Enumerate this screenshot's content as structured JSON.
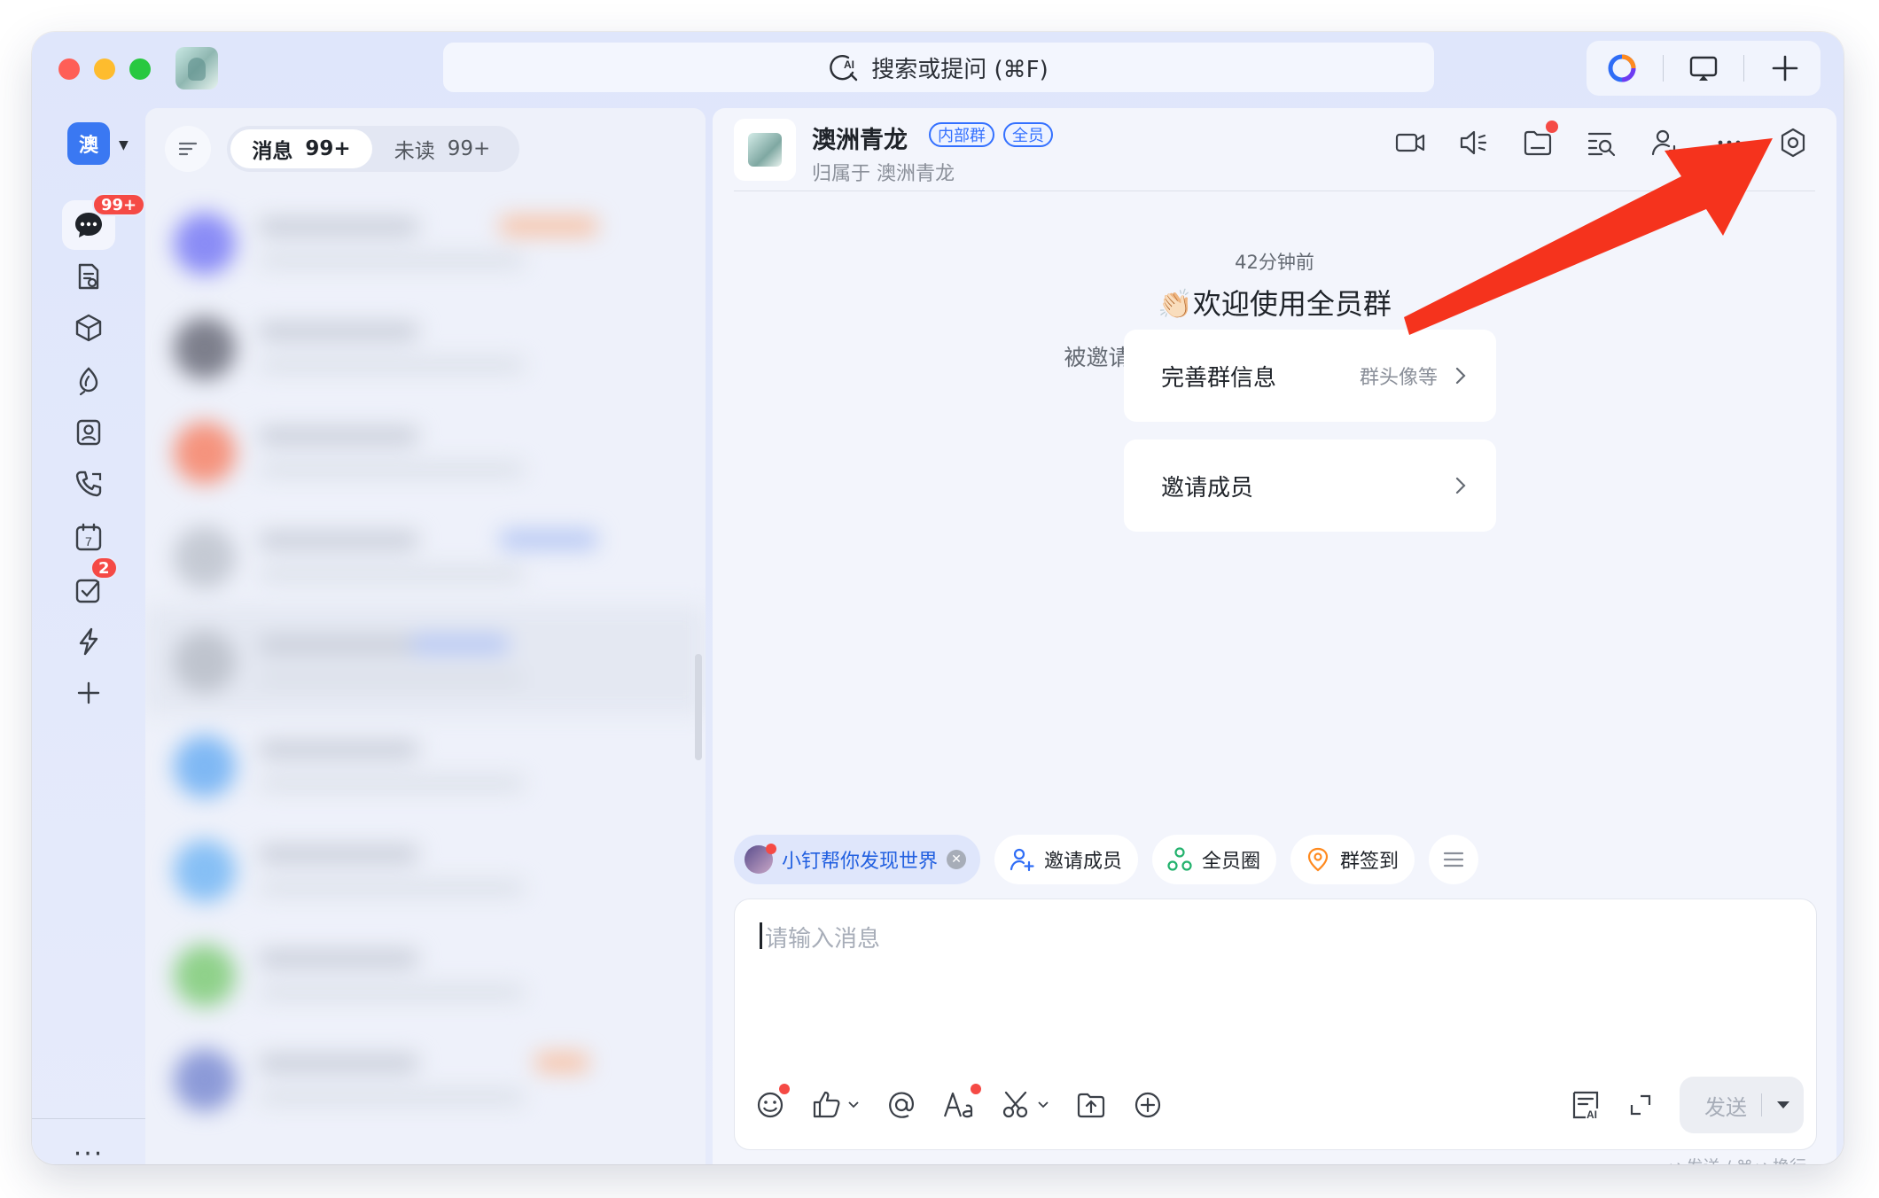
{
  "search": {
    "label": "搜索或提问 (⌘F)"
  },
  "org": {
    "initial": "澳"
  },
  "rail": {
    "messages_badge": "99+",
    "todo_badge": "2",
    "items": [
      "messages-icon",
      "docs-icon",
      "workbench-icon",
      "ai-icon",
      "contacts-icon",
      "call-icon",
      "calendar-icon",
      "todo-icon",
      "flash-icon",
      "add-icon"
    ],
    "calendar_day": "7",
    "more": "···"
  },
  "list": {
    "tab_messages": "消息",
    "tab_messages_count": "99+",
    "tab_unread": "未读",
    "tab_unread_count": "99+"
  },
  "chat": {
    "group_name": "澳洲青龙",
    "tag_internal": "内部群",
    "tag_all": "全员",
    "belongs_to": "归属于 澳洲青龙",
    "time": "42分钟前",
    "welcome_emoji": "👏🏻",
    "welcome": "欢迎使用全员群",
    "welcome_sub": "被邀请加入组织的同事，也会自动进入本群",
    "card_info_title": "完善群信息",
    "card_info_hint": "群头像等",
    "card_invite_title": "邀请成员"
  },
  "quick": {
    "promo": "小钉帮你发现世界",
    "invite": "邀请成员",
    "circle": "全员圈",
    "checkin": "群签到"
  },
  "composer": {
    "placeholder": "请输入消息",
    "send": "发送",
    "hint": "↩ 发送 / ⌘↩ 换行"
  },
  "colors": {
    "accent": "#3370ff",
    "badge": "#f54a45",
    "arrow": "#f5331d"
  }
}
